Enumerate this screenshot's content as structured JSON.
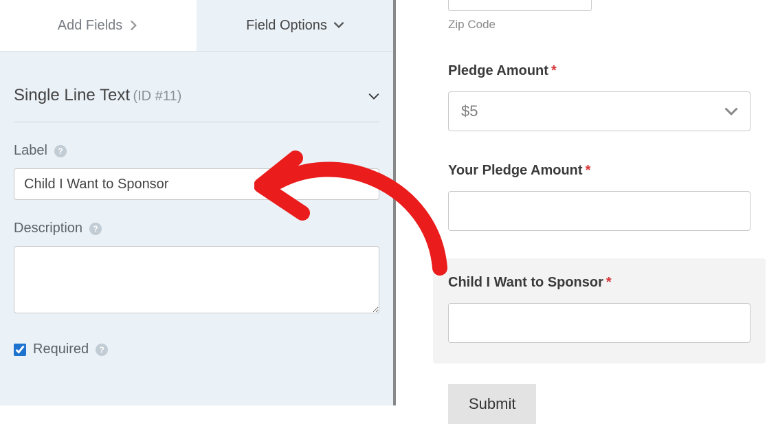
{
  "tabs": {
    "add_fields": "Add Fields",
    "field_options": "Field Options"
  },
  "field_panel": {
    "title": "Single Line Text",
    "id_label": "(ID #11)",
    "label_text": "Label",
    "label_value": "Child I Want to Sponsor",
    "description_text": "Description",
    "description_value": "",
    "required_text": "Required"
  },
  "preview": {
    "zip_sublabel": "Zip Code",
    "pledge_label": "Pledge Amount",
    "pledge_value": "$5",
    "your_pledge_label": "Your Pledge Amount",
    "sponsor_label": "Child I Want to Sponsor",
    "submit": "Submit"
  },
  "glyphs": {
    "chevron_right": "›",
    "chevron_down": "⌄"
  }
}
